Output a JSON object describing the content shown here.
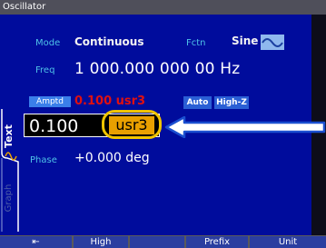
{
  "window": {
    "title": "Oscillator"
  },
  "mode": {
    "label": "Mode",
    "value": "Continuous"
  },
  "function": {
    "label": "Fctn",
    "value": "Sine",
    "icon": "sine-wave-icon"
  },
  "frequency": {
    "label": "Freq",
    "value": "1 000.000 000 00 Hz"
  },
  "amplitude": {
    "label": "Amptd",
    "current": "0.100 usr3",
    "buttons": {
      "auto": "Auto",
      "highz": "High-Z"
    }
  },
  "entry": {
    "number": "0.100",
    "unit": "usr3"
  },
  "phase": {
    "label": "Phase",
    "value": "+0.000 deg"
  },
  "side_tabs": {
    "text": "Text",
    "graph": "Graph"
  },
  "softkeys": {
    "back": "⇤",
    "high": "High",
    "prefix": "Prefix",
    "unit": "Unit"
  },
  "colors": {
    "panel": "#000c9c",
    "label": "#4ec2e8",
    "accent": "#e9a000",
    "highlight": "#f0c400",
    "arrow": "#1a4fd0",
    "error_text": "#e01010"
  }
}
